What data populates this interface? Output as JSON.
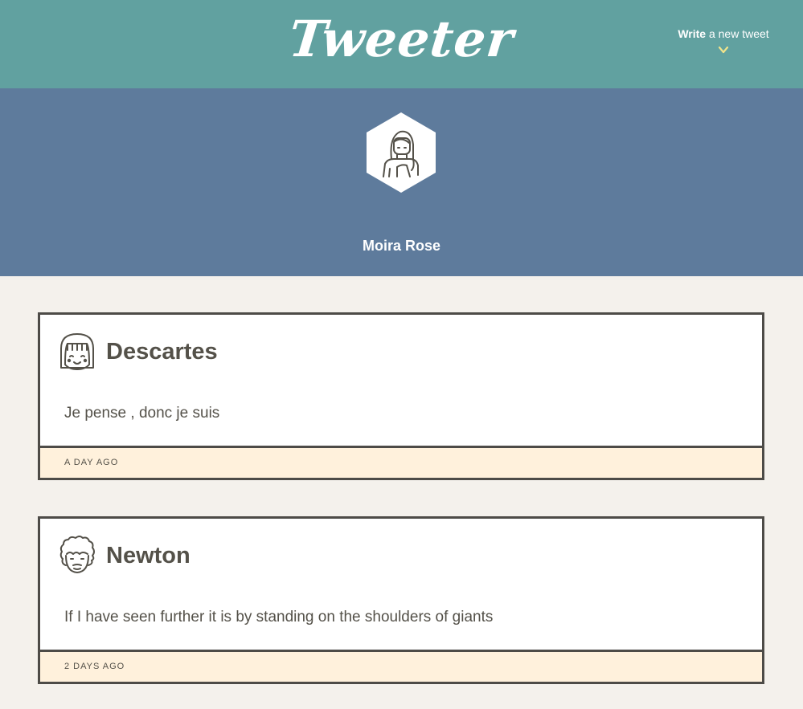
{
  "header": {
    "logo_text": "Tweeter",
    "compose_strong": "Write",
    "compose_rest": " a new tweet",
    "compose_icon": "chevron-down-icon",
    "colors": {
      "bar": "#61a1a0",
      "chevron": "#f2e48a"
    }
  },
  "profile": {
    "name": "Moira Rose",
    "avatar_icon": "woman-avatar-icon",
    "colors": {
      "band": "#5e7b9c"
    }
  },
  "tweets": [
    {
      "author": "Descartes",
      "avatar_icon": "girl-face-avatar-icon",
      "text": "Je pense , donc je suis",
      "time": "A DAY AGO"
    },
    {
      "author": "Newton",
      "avatar_icon": "curly-hair-face-avatar-icon",
      "text": "If I have seen further it is by standing on the shoulders of giants",
      "time": "2 DAYS AGO"
    }
  ],
  "colors": {
    "page_bg": "#f4f1ec",
    "card_border": "#4d4b47",
    "footer_bg": "#fff1dc",
    "text": "#545149"
  }
}
